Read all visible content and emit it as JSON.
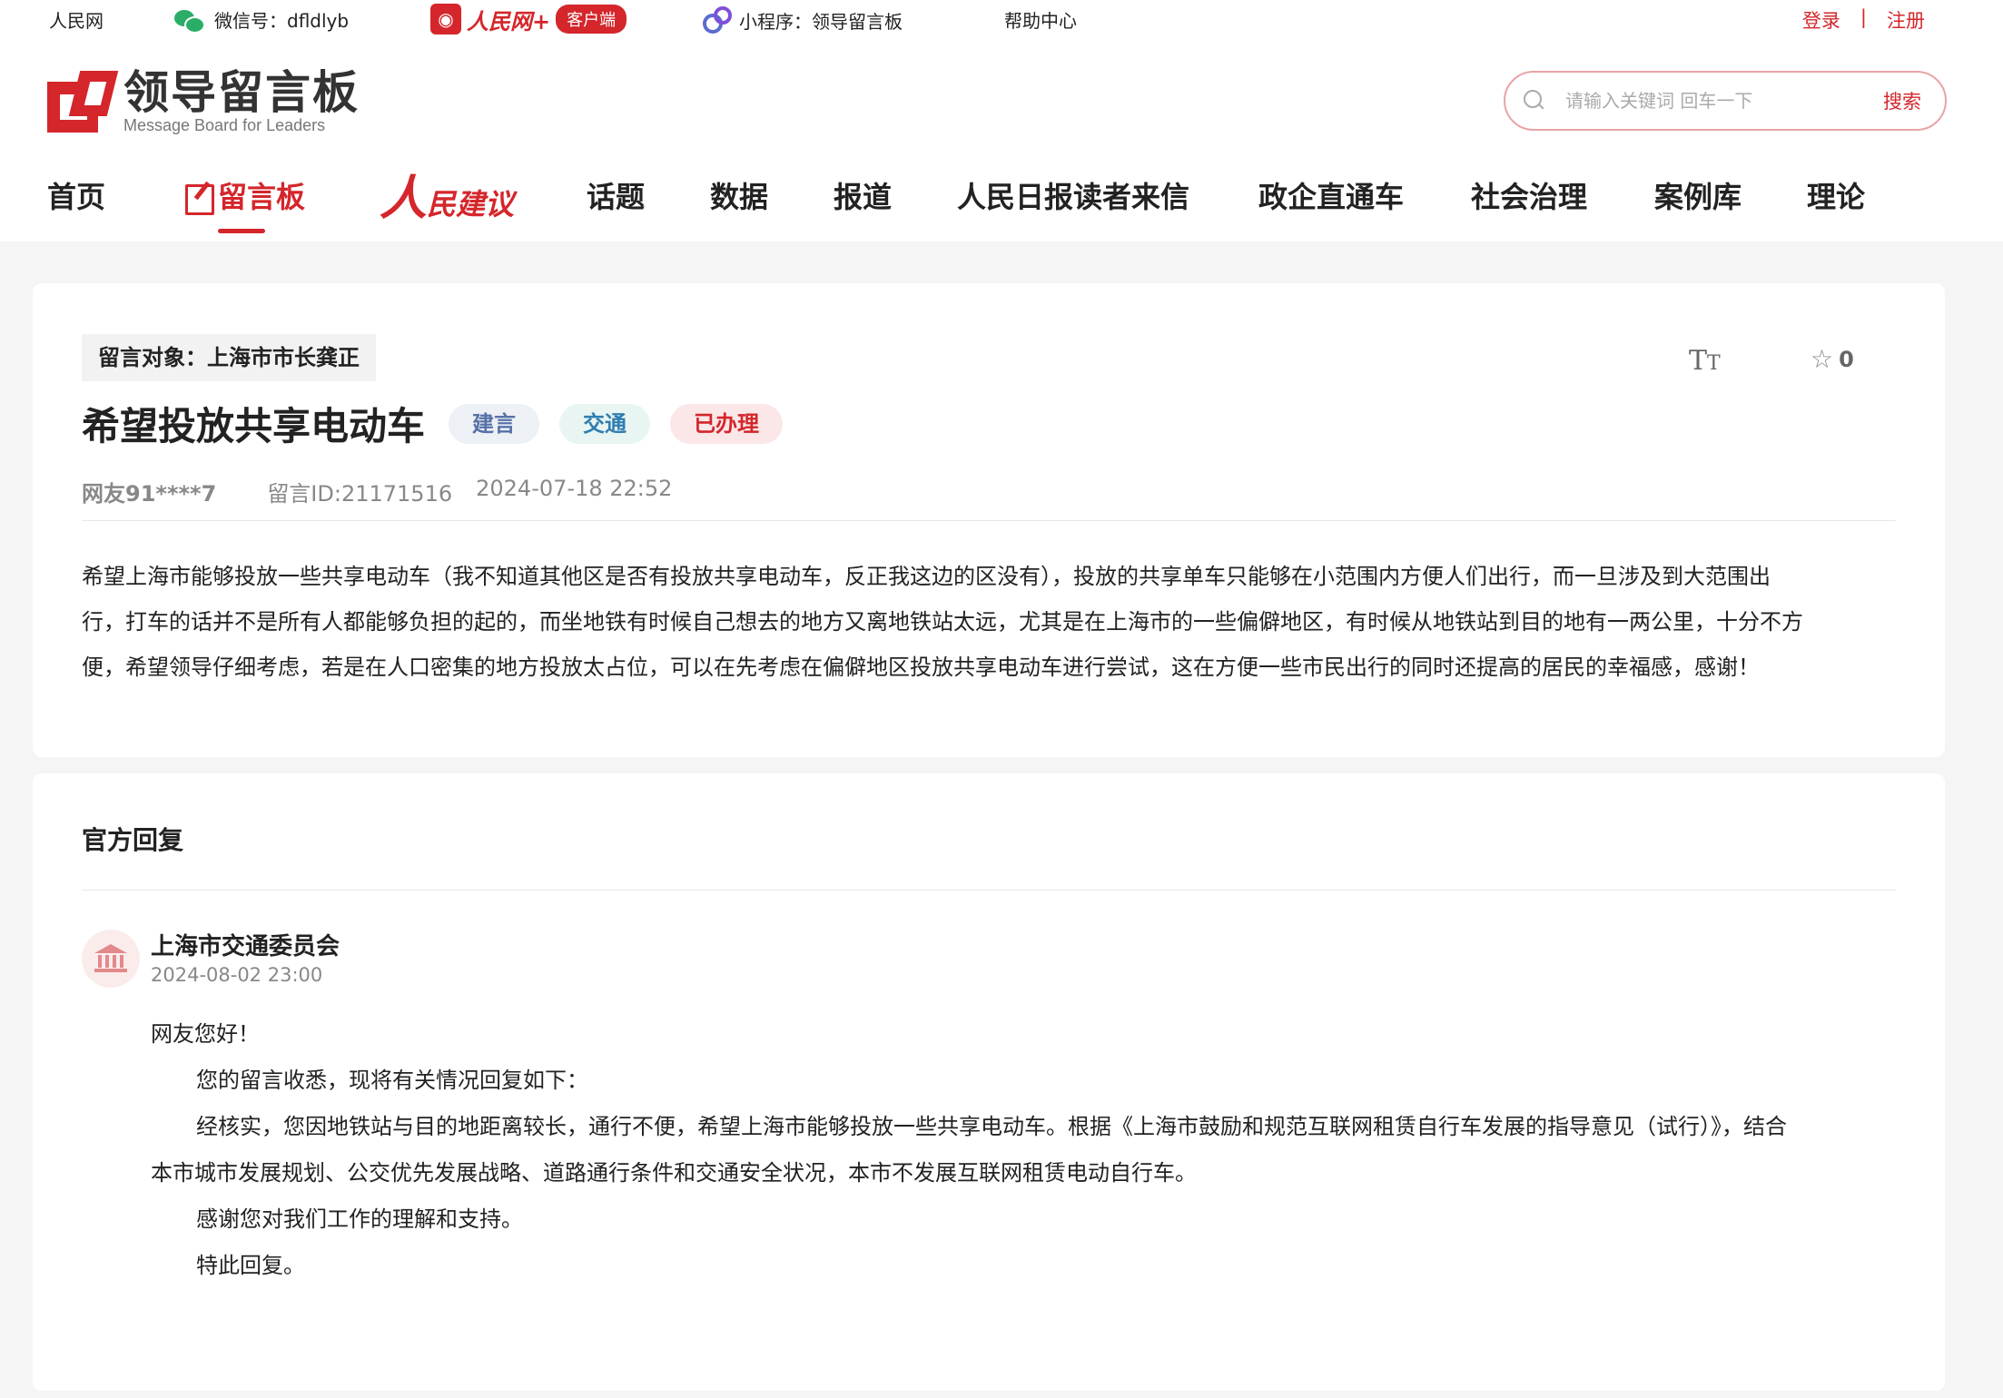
{
  "topbar": {
    "site": "人民网",
    "wechat_label": "微信号：dfldlyb",
    "people_plus_text": "人民网+",
    "people_plus_badge": "客户端",
    "mini_program": "小程序：领导留言板",
    "help": "帮助中心",
    "login": "登录",
    "separator": "|",
    "register": "注册"
  },
  "brand": {
    "title": "领导留言板",
    "subtitle": "Message Board for Leaders"
  },
  "search": {
    "placeholder": "请输入关键词 回车一下",
    "button": "搜索"
  },
  "nav": {
    "items": [
      {
        "label": "首页"
      },
      {
        "label": "留言板",
        "active": true
      },
      {
        "label_big": "人",
        "label_rest": "民建议"
      },
      {
        "label": "话题"
      },
      {
        "label": "数据"
      },
      {
        "label": "报道"
      },
      {
        "label": "人民日报读者来信"
      },
      {
        "label": "政企直通车"
      },
      {
        "label": "社会治理"
      },
      {
        "label": "案例库"
      },
      {
        "label": "理论"
      }
    ]
  },
  "message": {
    "target_label": "留言对象：",
    "target": "上海市市长龚正",
    "title": "希望投放共享电动车",
    "tags": [
      "建言",
      "交通",
      "已办理"
    ],
    "favorite_count": "0",
    "font_size_icon": "T",
    "font_size_icon_small": "T",
    "user": "网友91****7",
    "id_label": "留言ID:21171516",
    "time": "2024-07-18 22:52",
    "content_lines": [
      "希望上海市能够投放一些共享电动车（我不知道其他区是否有投放共享电动车，反正我这边的区没有），投放的共享单车只能够在小范围内方便人们出行，而一旦涉及到大范围出",
      "行，打车的话并不是所有人都能够负担的起的，而坐地铁有时候自己想去的地方又离地铁站太远，尤其是在上海市的一些偏僻地区，有时候从地铁站到目的地有一两公里，十分不方",
      "便，希望领导仔细考虑，若是在人口密集的地方投放太占位，可以在先考虑在偏僻地区投放共享电动车进行尝试，这在方便一些市民出行的同时还提高的居民的幸福感，感谢！"
    ]
  },
  "reply": {
    "heading": "官方回复",
    "org": "上海市交通委员会",
    "time": "2024-08-02 23:00",
    "lines": [
      "网友您好！",
      "您的留言收悉，现将有关情况回复如下：",
      "经核实，您因地铁站与目的地距离较长，通行不便，希望上海市能够投放一些共享电动车。根据《上海市鼓励和规范互联网租赁自行车发展的指导意见（试行）》，结合",
      "本市城市发展规划、公交优先发展战略、道路通行条件和交通安全状况，本市不发展互联网租赁电动自行车。",
      "感谢您对我们工作的理解和支持。",
      "特此回复。"
    ]
  }
}
